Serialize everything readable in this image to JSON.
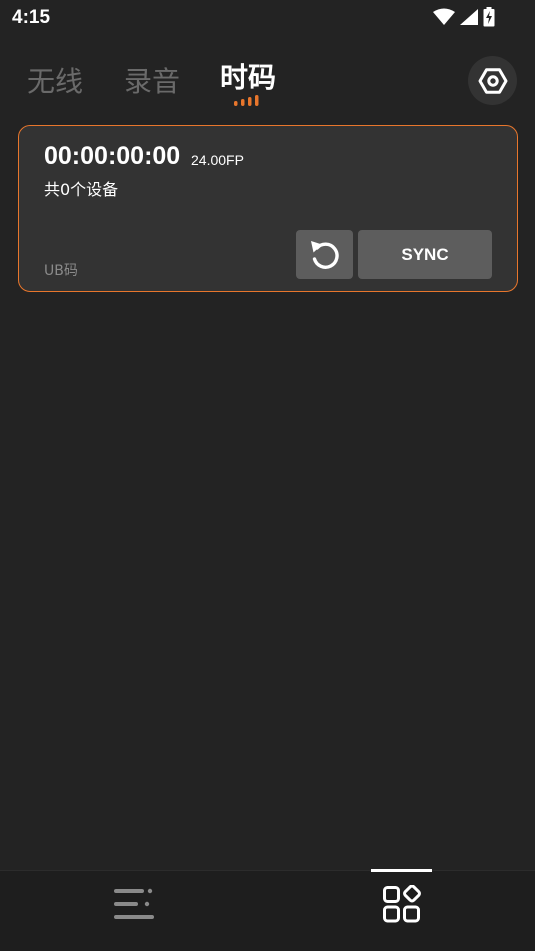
{
  "status_bar": {
    "time": "4:15",
    "icons": [
      "wifi-icon",
      "cellular-signal-icon",
      "battery-charging-icon"
    ]
  },
  "tabs": [
    {
      "label": "无线",
      "active": false
    },
    {
      "label": "录音",
      "active": false
    },
    {
      "label": "时码",
      "active": true
    }
  ],
  "header": {
    "settings_icon": "hexagon-settings-icon"
  },
  "card": {
    "timecode": "00:00:00:00",
    "fps": "24.00FP",
    "device_count": "共0个设备",
    "code_type": "UB码",
    "reset_icon": "reset-arrow-icon",
    "sync_label": "SYNC"
  },
  "bottom_nav": {
    "items": [
      {
        "icon": "list-menu-icon",
        "active": false
      },
      {
        "icon": "apps-grid-icon",
        "active": true
      }
    ]
  },
  "colors": {
    "background": "#232323",
    "card": "#333333",
    "accent": "#e8762c",
    "button": "#5d5d5d",
    "inactive_text": "#6a6a6a"
  }
}
